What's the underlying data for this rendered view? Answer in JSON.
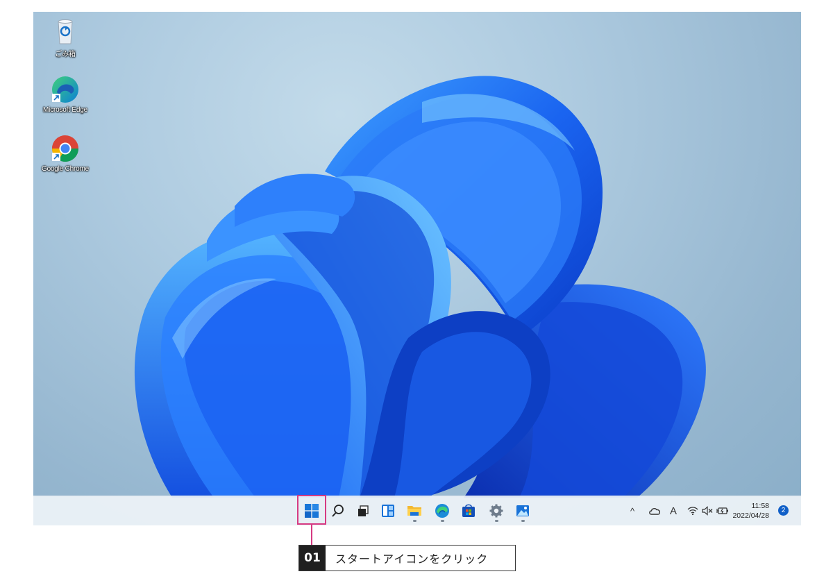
{
  "desktop": {
    "icons": [
      {
        "label": "ごみ箱",
        "icon": "recycle-bin-icon"
      },
      {
        "label": "Microsoft Edge",
        "icon": "edge-icon"
      },
      {
        "label": "Google Chrome",
        "icon": "chrome-icon"
      }
    ]
  },
  "taskbar": {
    "apps": [
      {
        "icon": "windows-start-icon"
      },
      {
        "icon": "search-icon"
      },
      {
        "icon": "task-view-icon"
      },
      {
        "icon": "widgets-icon"
      },
      {
        "icon": "file-explorer-icon"
      },
      {
        "icon": "edge-icon"
      },
      {
        "icon": "store-icon"
      },
      {
        "icon": "settings-icon"
      },
      {
        "icon": "photos-icon"
      }
    ],
    "tray": {
      "chevron": "^",
      "ime": "A",
      "time": "11:58",
      "date": "2022/04/28",
      "notification_count": "2"
    }
  },
  "callout": {
    "number": "01",
    "text": "スタートアイコンをクリック",
    "color": "#d63a82"
  }
}
